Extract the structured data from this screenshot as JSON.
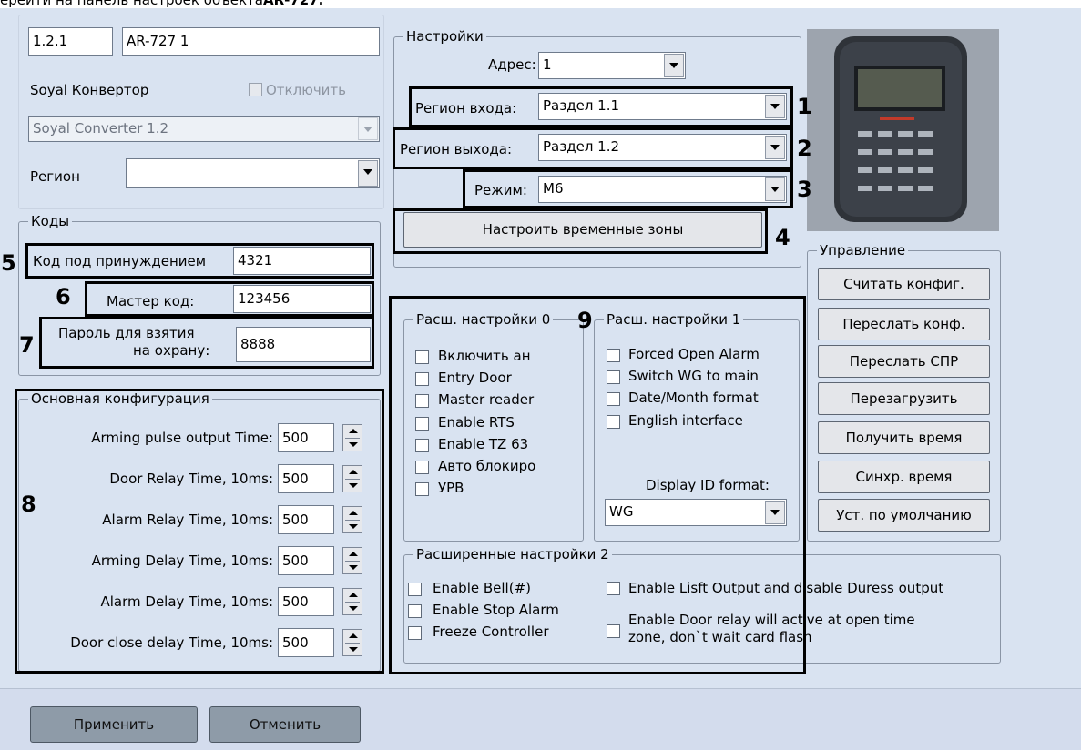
{
  "caption": "ерейти на панель настроек объекта",
  "caption_bold": "AR-727.",
  "device": {
    "id": "1.2.1",
    "name": "AR-727 1",
    "converter_label": "Soyal Конвертор",
    "disable_label": "Отключить",
    "converter_value": "Soyal Converter 1.2",
    "region_label": "Регион",
    "region_value": ""
  },
  "settings": {
    "legend": "Настройки",
    "address_label": "Адрес:",
    "address_value": "1",
    "entry_label": "Регион входа:",
    "entry_value": "Раздел 1.1",
    "exit_label": "Регион выхода:",
    "exit_value": "Раздел 1.2",
    "mode_label": "Режим:",
    "mode_value": "М6",
    "timezones_button": "Настроить временные зоны"
  },
  "codes": {
    "legend": "Коды",
    "duress_label": "Код под принуждением",
    "duress_value": "4321",
    "master_label": "Мастер код:",
    "master_value": "123456",
    "arm_label_1": "Пароль для взятия",
    "arm_label_2": "на охрану:",
    "arm_value": "8888"
  },
  "main_config": {
    "legend": "Основная конфигурация",
    "rows": [
      {
        "label": "Arming pulse output Time:",
        "value": "500"
      },
      {
        "label": "Door Relay Time, 10ms:",
        "value": "500"
      },
      {
        "label": "Alarm Relay Time, 10ms:",
        "value": "500"
      },
      {
        "label": "Arming Delay Time, 10ms:",
        "value": "500"
      },
      {
        "label": "Alarm Delay Time, 10ms:",
        "value": "500"
      },
      {
        "label": "Door close delay Time, 10ms:",
        "value": "500"
      }
    ]
  },
  "ext0": {
    "legend": "Расш. настройки 0",
    "items": [
      "Включить ан",
      "Entry Door",
      "Master reader",
      "Enable RTS",
      "Enable TZ 63",
      "Авто блокиро",
      "УРВ"
    ]
  },
  "ext1": {
    "legend": "Расш. настройки 1",
    "items": [
      "Forced Open Alarm",
      "Switch WG to main",
      "Date/Month format",
      "English interface"
    ],
    "display_label": "Display ID format:",
    "display_value": "WG"
  },
  "ext2": {
    "legend": "Расширенные настройки 2",
    "items": [
      "Enable Bell(#)",
      "Enable Stop Alarm",
      "Freeze Controller"
    ],
    "lift": "Enable Lisft Output and disable Duress output",
    "door_relay_1": "Enable Door relay will active at open time",
    "door_relay_2": "zone, don`t wait card flash"
  },
  "control": {
    "legend": "Управление",
    "buttons": [
      "Считать конфиг.",
      "Переслать конф.",
      "Переслать СПР",
      "Перезагрузить",
      "Получить время",
      "Синхр. время",
      "Уст. по умолчанию"
    ]
  },
  "footer": {
    "apply": "Применить",
    "cancel": "Отменить"
  },
  "markers": [
    "1",
    "2",
    "3",
    "4",
    "5",
    "6",
    "7",
    "8",
    "9"
  ]
}
